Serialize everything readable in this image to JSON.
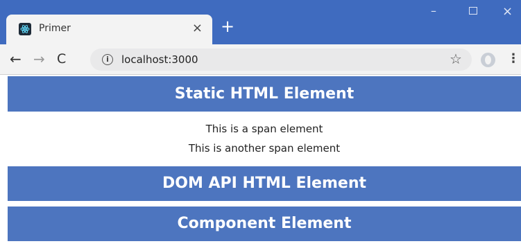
{
  "browser": {
    "tab_title": "Primer",
    "tab_close": "×",
    "new_tab": "+",
    "window_controls": {
      "minimize": "–",
      "maximize": "",
      "close": "×"
    },
    "nav": {
      "back": "←",
      "forward": "→",
      "reload": "C"
    },
    "omnibox": {
      "info_icon": "i",
      "url": "localhost:3000"
    },
    "star_icon": "☆",
    "menu_icon": "⋮",
    "colors": {
      "titlebar": "#3f6bbf",
      "toolbar": "#f3f3f3",
      "omnibox": "#e9e9ea"
    }
  },
  "page": {
    "static_heading": "Static HTML Element",
    "spans": [
      "This is a span element",
      "This is another span element"
    ],
    "dom_heading": "DOM API HTML Element",
    "component_heading": "Component Element",
    "colors": {
      "heading_bg": "#4d75bf",
      "heading_text": "#ffffff"
    }
  }
}
